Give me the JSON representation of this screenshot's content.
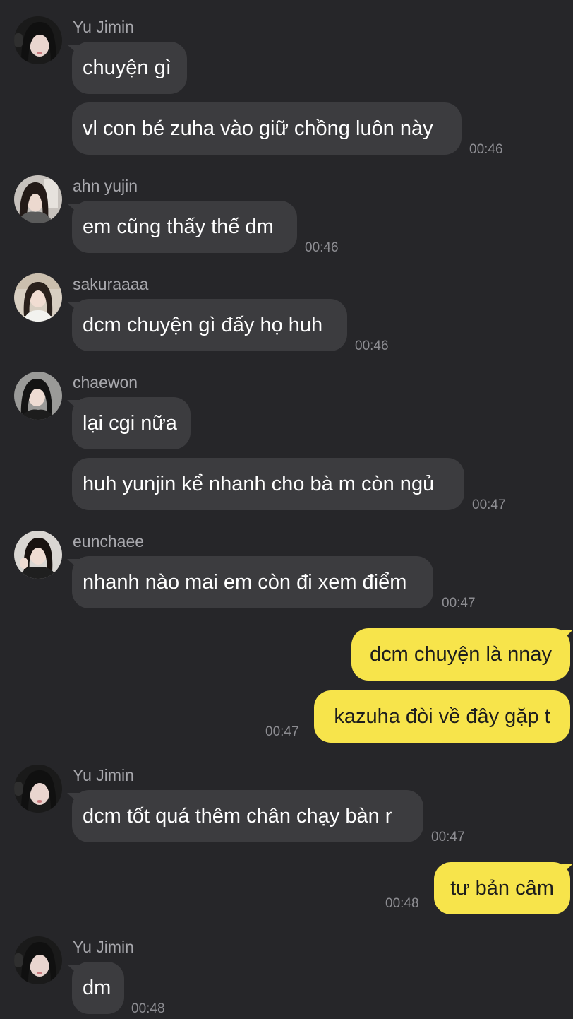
{
  "colors": {
    "background": "#262629",
    "incoming_bubble": "#3c3c3f",
    "outgoing_bubble": "#f7e44b",
    "sender_name": "#a8a8ad",
    "timestamp": "#8d8d92"
  },
  "messages": [
    {
      "sender": "Yu Jimin",
      "lines": [
        "chuyện gì",
        "vl con bé zuha vào giữ chồng luôn này"
      ],
      "time": "00:46"
    },
    {
      "sender": "ahn yujin",
      "lines": [
        "em cũng thấy thế dm"
      ],
      "time": "00:46"
    },
    {
      "sender": "sakuraaaa",
      "lines": [
        "dcm chuyện gì đấy họ huh"
      ],
      "time": "00:46"
    },
    {
      "sender": "chaewon",
      "lines": [
        "lại cgi nữa",
        "huh yunjin kể nhanh cho bà m còn ngủ"
      ],
      "time": "00:47"
    },
    {
      "sender": "eunchaee",
      "lines": [
        "nhanh nào mai em còn đi xem điểm"
      ],
      "time": "00:47"
    },
    {
      "sender": "me",
      "lines": [
        "dcm chuyện là nnay",
        "kazuha đòi về đây gặp t"
      ],
      "time": "00:47"
    },
    {
      "sender": "Yu Jimin",
      "lines": [
        "dcm tốt quá thêm chân chạy bàn r"
      ],
      "time": "00:47"
    },
    {
      "sender": "me",
      "lines": [
        "tư bản câm"
      ],
      "time": "00:48"
    },
    {
      "sender": "Yu Jimin",
      "lines": [
        "dm"
      ],
      "time": "00:48"
    }
  ]
}
